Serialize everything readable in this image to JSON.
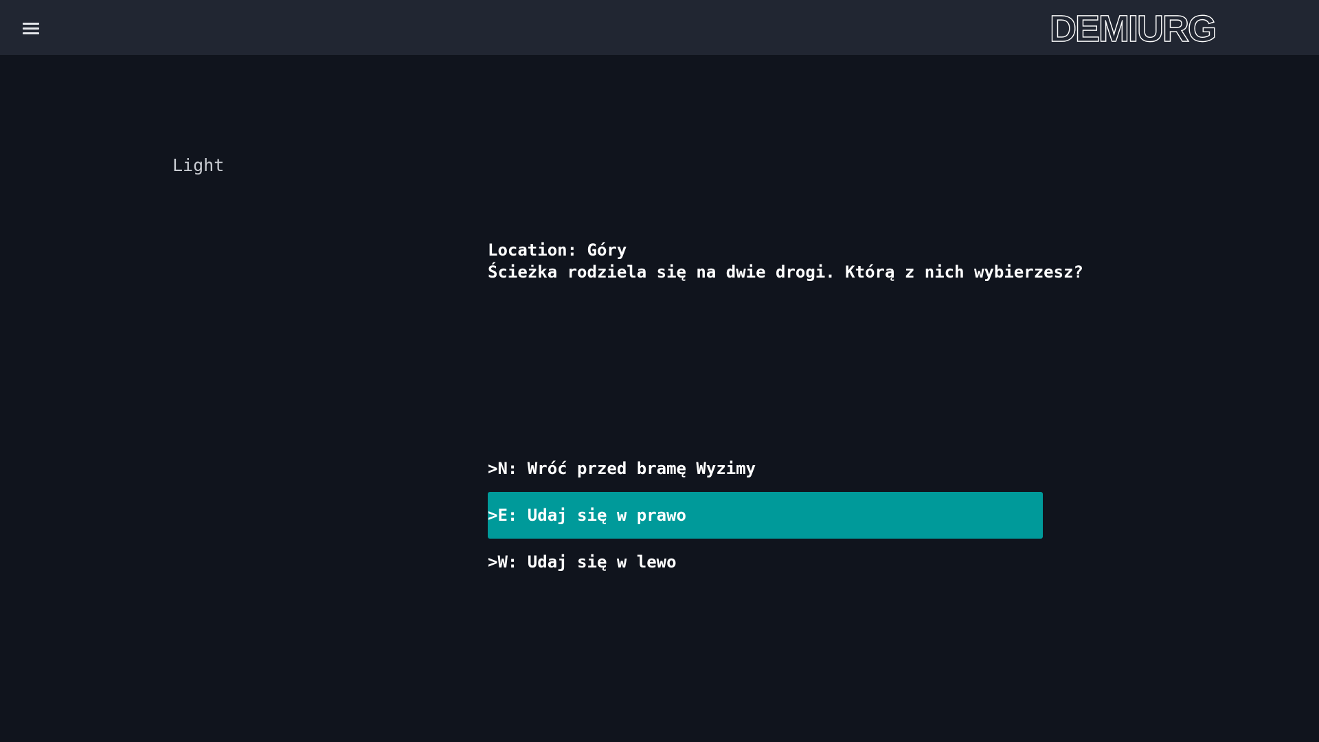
{
  "header": {
    "menu_icon": "hamburger-menu-icon",
    "logo": "DEMIURG"
  },
  "theme_toggle": {
    "label": "Light"
  },
  "story": {
    "location_line": "Location: Góry",
    "description": "Ścieżka rodziela się na dwie drogi. Którą z nich wybierzesz?"
  },
  "choices": [
    {
      "label": ">N: Wróć przed bramę Wyzimy",
      "selected": false
    },
    {
      "label": ">E: Udaj się w prawo",
      "selected": true
    },
    {
      "label": ">W: Udaj się w lewo",
      "selected": false
    }
  ],
  "colors": {
    "background": "#10141d",
    "topbar": "#212632",
    "selected_choice": "#009a9a",
    "text": "#ffffff",
    "muted_text": "#c9ccd2"
  }
}
